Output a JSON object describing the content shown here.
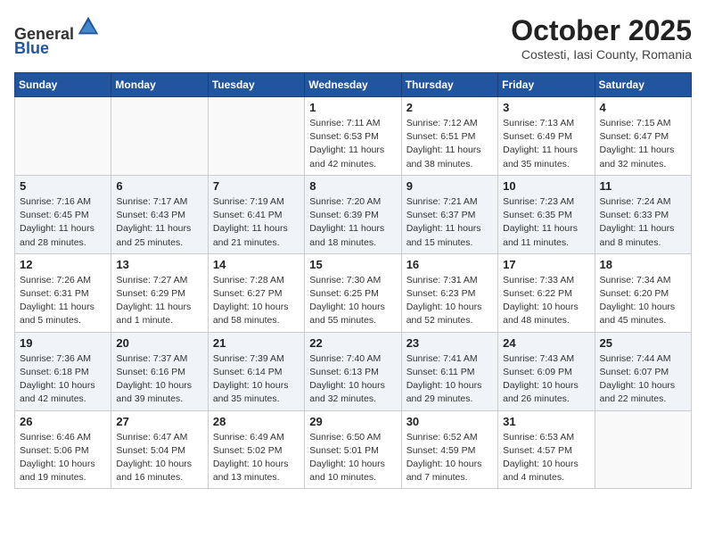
{
  "header": {
    "logo_general": "General",
    "logo_blue": "Blue",
    "title": "October 2025",
    "subtitle": "Costesti, Iasi County, Romania"
  },
  "weekdays": [
    "Sunday",
    "Monday",
    "Tuesday",
    "Wednesday",
    "Thursday",
    "Friday",
    "Saturday"
  ],
  "weeks": [
    [
      {
        "day": "",
        "info": ""
      },
      {
        "day": "",
        "info": ""
      },
      {
        "day": "",
        "info": ""
      },
      {
        "day": "1",
        "info": "Sunrise: 7:11 AM\nSunset: 6:53 PM\nDaylight: 11 hours\nand 42 minutes."
      },
      {
        "day": "2",
        "info": "Sunrise: 7:12 AM\nSunset: 6:51 PM\nDaylight: 11 hours\nand 38 minutes."
      },
      {
        "day": "3",
        "info": "Sunrise: 7:13 AM\nSunset: 6:49 PM\nDaylight: 11 hours\nand 35 minutes."
      },
      {
        "day": "4",
        "info": "Sunrise: 7:15 AM\nSunset: 6:47 PM\nDaylight: 11 hours\nand 32 minutes."
      }
    ],
    [
      {
        "day": "5",
        "info": "Sunrise: 7:16 AM\nSunset: 6:45 PM\nDaylight: 11 hours\nand 28 minutes."
      },
      {
        "day": "6",
        "info": "Sunrise: 7:17 AM\nSunset: 6:43 PM\nDaylight: 11 hours\nand 25 minutes."
      },
      {
        "day": "7",
        "info": "Sunrise: 7:19 AM\nSunset: 6:41 PM\nDaylight: 11 hours\nand 21 minutes."
      },
      {
        "day": "8",
        "info": "Sunrise: 7:20 AM\nSunset: 6:39 PM\nDaylight: 11 hours\nand 18 minutes."
      },
      {
        "day": "9",
        "info": "Sunrise: 7:21 AM\nSunset: 6:37 PM\nDaylight: 11 hours\nand 15 minutes."
      },
      {
        "day": "10",
        "info": "Sunrise: 7:23 AM\nSunset: 6:35 PM\nDaylight: 11 hours\nand 11 minutes."
      },
      {
        "day": "11",
        "info": "Sunrise: 7:24 AM\nSunset: 6:33 PM\nDaylight: 11 hours\nand 8 minutes."
      }
    ],
    [
      {
        "day": "12",
        "info": "Sunrise: 7:26 AM\nSunset: 6:31 PM\nDaylight: 11 hours\nand 5 minutes."
      },
      {
        "day": "13",
        "info": "Sunrise: 7:27 AM\nSunset: 6:29 PM\nDaylight: 11 hours\nand 1 minute."
      },
      {
        "day": "14",
        "info": "Sunrise: 7:28 AM\nSunset: 6:27 PM\nDaylight: 10 hours\nand 58 minutes."
      },
      {
        "day": "15",
        "info": "Sunrise: 7:30 AM\nSunset: 6:25 PM\nDaylight: 10 hours\nand 55 minutes."
      },
      {
        "day": "16",
        "info": "Sunrise: 7:31 AM\nSunset: 6:23 PM\nDaylight: 10 hours\nand 52 minutes."
      },
      {
        "day": "17",
        "info": "Sunrise: 7:33 AM\nSunset: 6:22 PM\nDaylight: 10 hours\nand 48 minutes."
      },
      {
        "day": "18",
        "info": "Sunrise: 7:34 AM\nSunset: 6:20 PM\nDaylight: 10 hours\nand 45 minutes."
      }
    ],
    [
      {
        "day": "19",
        "info": "Sunrise: 7:36 AM\nSunset: 6:18 PM\nDaylight: 10 hours\nand 42 minutes."
      },
      {
        "day": "20",
        "info": "Sunrise: 7:37 AM\nSunset: 6:16 PM\nDaylight: 10 hours\nand 39 minutes."
      },
      {
        "day": "21",
        "info": "Sunrise: 7:39 AM\nSunset: 6:14 PM\nDaylight: 10 hours\nand 35 minutes."
      },
      {
        "day": "22",
        "info": "Sunrise: 7:40 AM\nSunset: 6:13 PM\nDaylight: 10 hours\nand 32 minutes."
      },
      {
        "day": "23",
        "info": "Sunrise: 7:41 AM\nSunset: 6:11 PM\nDaylight: 10 hours\nand 29 minutes."
      },
      {
        "day": "24",
        "info": "Sunrise: 7:43 AM\nSunset: 6:09 PM\nDaylight: 10 hours\nand 26 minutes."
      },
      {
        "day": "25",
        "info": "Sunrise: 7:44 AM\nSunset: 6:07 PM\nDaylight: 10 hours\nand 22 minutes."
      }
    ],
    [
      {
        "day": "26",
        "info": "Sunrise: 6:46 AM\nSunset: 5:06 PM\nDaylight: 10 hours\nand 19 minutes."
      },
      {
        "day": "27",
        "info": "Sunrise: 6:47 AM\nSunset: 5:04 PM\nDaylight: 10 hours\nand 16 minutes."
      },
      {
        "day": "28",
        "info": "Sunrise: 6:49 AM\nSunset: 5:02 PM\nDaylight: 10 hours\nand 13 minutes."
      },
      {
        "day": "29",
        "info": "Sunrise: 6:50 AM\nSunset: 5:01 PM\nDaylight: 10 hours\nand 10 minutes."
      },
      {
        "day": "30",
        "info": "Sunrise: 6:52 AM\nSunset: 4:59 PM\nDaylight: 10 hours\nand 7 minutes."
      },
      {
        "day": "31",
        "info": "Sunrise: 6:53 AM\nSunset: 4:57 PM\nDaylight: 10 hours\nand 4 minutes."
      },
      {
        "day": "",
        "info": ""
      }
    ]
  ]
}
